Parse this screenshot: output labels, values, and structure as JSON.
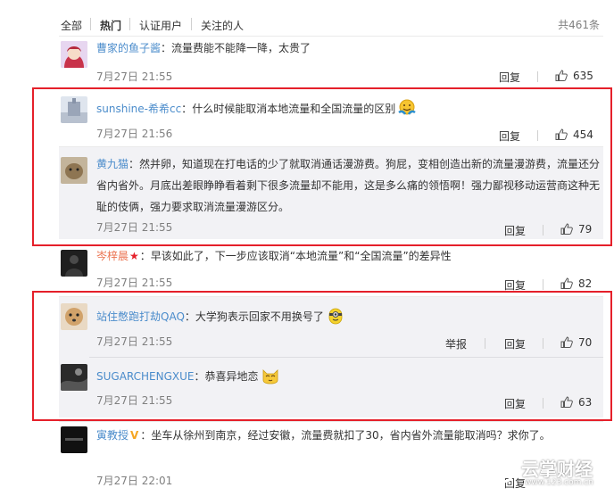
{
  "tabs": [
    {
      "label": "全部"
    },
    {
      "label": "热门"
    },
    {
      "label": "认证用户"
    },
    {
      "label": "关注的人"
    }
  ],
  "total": "共461条",
  "actions": {
    "reply": "回复",
    "report": "举报"
  },
  "colors": {
    "username": "#eb7350",
    "highlight": "#e5202a",
    "link": "#4b8ccb"
  },
  "comments": [
    {
      "user": "曹家的鱼子酱",
      "sep": "：",
      "text": "流量费能不能降一降，太贵了",
      "time": "7月27日 21:55",
      "likes": "635"
    },
    {
      "user": "sunshine-希希cc",
      "sep": "：",
      "text": "什么时候能取消本地流量和全国流量的区别",
      "time": "7月27日 21:56",
      "likes": "454"
    },
    {
      "user": "黄九猫",
      "sep": "：",
      "text_lines": [
        "然并卵，知道现在打电话的少了就取消通话漫游费。狗屁，变相创造出新的流量漫游费，流量还分",
        "省内省外。月底出差眼睁睁看着剩下很多流量却不能用，这是多么痛的领悟啊！强力鄙视移动运营商这种无",
        "耻的伎俩，强力要求取消流量漫游区分。"
      ],
      "time": "7月27日 21:55",
      "likes": "79"
    },
    {
      "user": "岑梓晨",
      "sep": "：",
      "text": "早该如此了，下一步应该取消“本地流量”和“全国流量”的差异性",
      "time": "7月27日 21:55",
      "likes": "82"
    },
    {
      "user": "站住憋跑打劫QAQ",
      "sep": "：",
      "text": "大学狗表示回家不用换号了",
      "time": "7月27日 21:55",
      "likes": "70"
    },
    {
      "user": "SUGARCHENGXUE",
      "sep": "：",
      "text": "恭喜异地恋",
      "time": "7月27日 21:55",
      "likes": "63"
    },
    {
      "user": "寅教授",
      "sep": "：",
      "text": "坐车从徐州到南京，经过安徽，流量费就扣了30，省内省外流量能取消吗？求你了。",
      "time": "7月27日 22:01",
      "likes": ""
    }
  ],
  "watermark": {
    "name": "云掌财经",
    "url": "www.123.com.cn"
  }
}
